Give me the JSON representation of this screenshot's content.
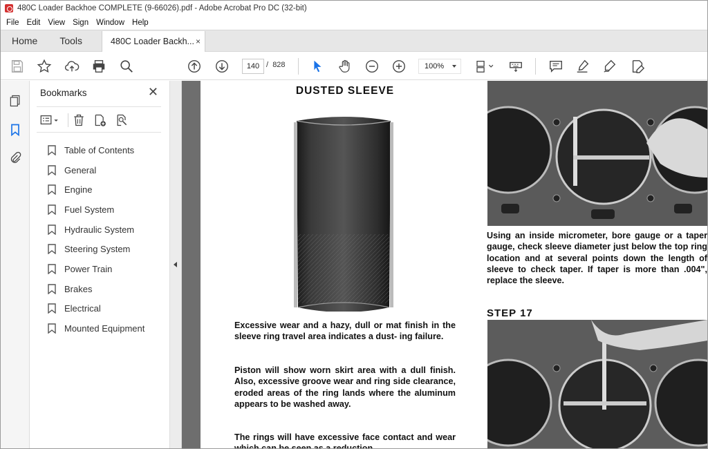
{
  "window": {
    "title": "480C Loader Backhoe COMPLETE (9-66026).pdf - Adobe Acrobat Pro DC (32-bit)"
  },
  "menu": [
    "File",
    "Edit",
    "View",
    "Sign",
    "Window",
    "Help"
  ],
  "tabs": {
    "home": "Home",
    "tools": "Tools",
    "document": "480C Loader Backh...",
    "close": "×"
  },
  "toolbar": {
    "current_page": "140",
    "page_separator": "/",
    "total_pages": "828",
    "zoom": "100%"
  },
  "bookmarks_panel": {
    "title": "Bookmarks",
    "close": "✕",
    "items": [
      "Table of Contents",
      "General",
      "Engine",
      "Fuel System",
      "Hydraulic System",
      "Steering System",
      "Power Train",
      "Brakes",
      "Electrical",
      "Mounted Equipment"
    ]
  },
  "document": {
    "heading": "DUSTED SLEEVE",
    "paragraph1": "Excessive wear and a hazy, dull or mat finish in the sleeve ring travel area indicates a dust- ing failure.",
    "paragraph2": "Piston will show worn skirt area with a dull finish. Also, excessive groove wear and ring side clearance, eroded areas of the ring lands where the aluminum appears to be washed away.",
    "paragraph3": "The rings will have excessive face contact and wear which can be seen as a reduction",
    "paragraph4": "Using an inside micrometer, bore gauge or a taper gauge, check sleeve diameter just below the top ring location and at several points down the length of sleeve to check taper. If taper is more than .004\", replace the sleeve.",
    "step": "STEP 17"
  }
}
